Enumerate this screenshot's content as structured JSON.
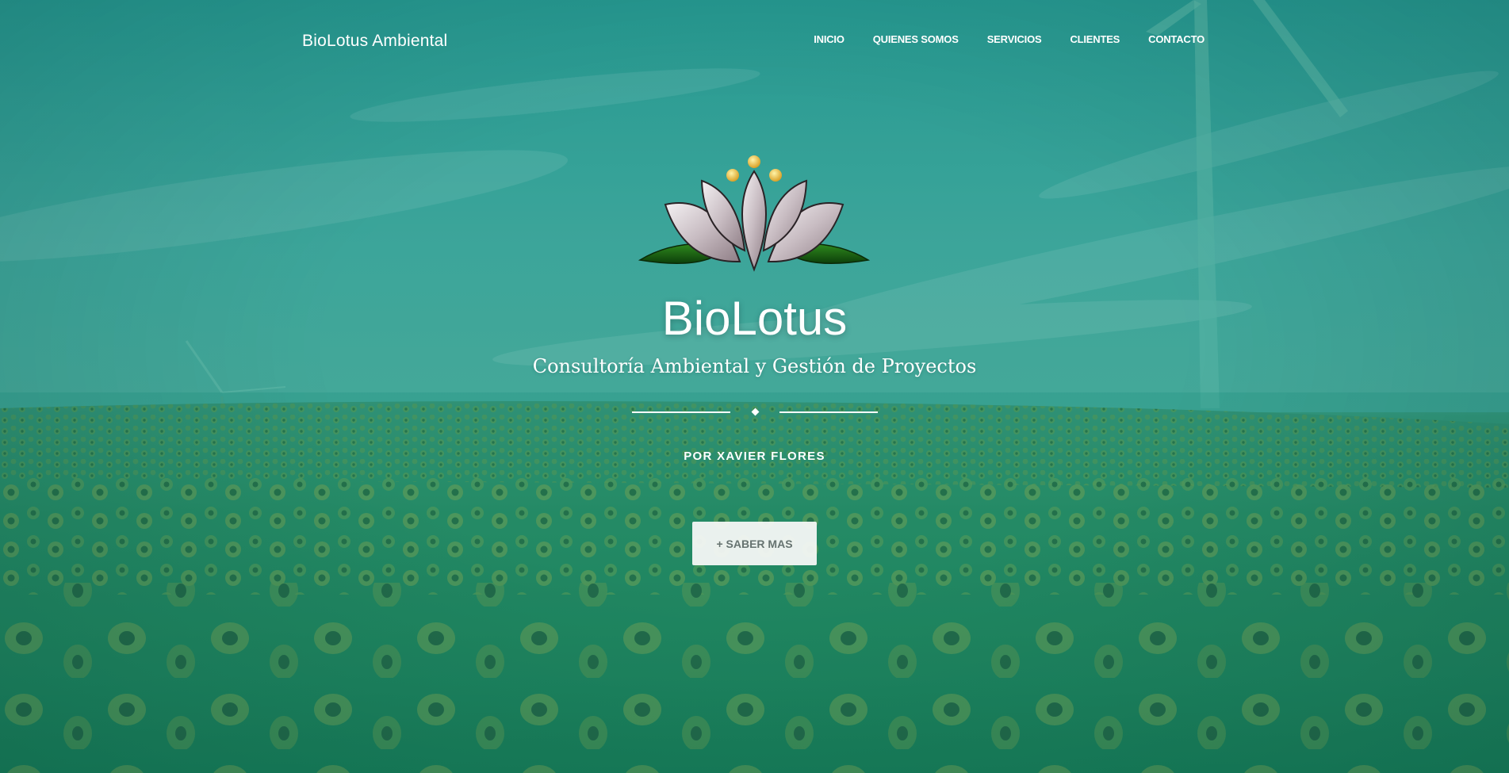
{
  "header": {
    "brand": "BioLotus Ambiental",
    "nav": [
      "INICIO",
      "QUIENES SOMOS",
      "SERVICIOS",
      "CLIENTES",
      "CONTACTO"
    ]
  },
  "hero": {
    "logo_icon": "lotus-flower-icon",
    "title": "BioLotus",
    "subtitle": "Consultoría Ambiental y Gestión de Proyectos",
    "byline": "POR XAVIER FLORES",
    "cta_label": "+ SABER MAS"
  },
  "colors": {
    "overlay_teal": "#2d9e96",
    "field_green": "#1f8458",
    "text": "#ffffff",
    "button_bg": "#f6f8f7",
    "button_text": "#667370"
  }
}
